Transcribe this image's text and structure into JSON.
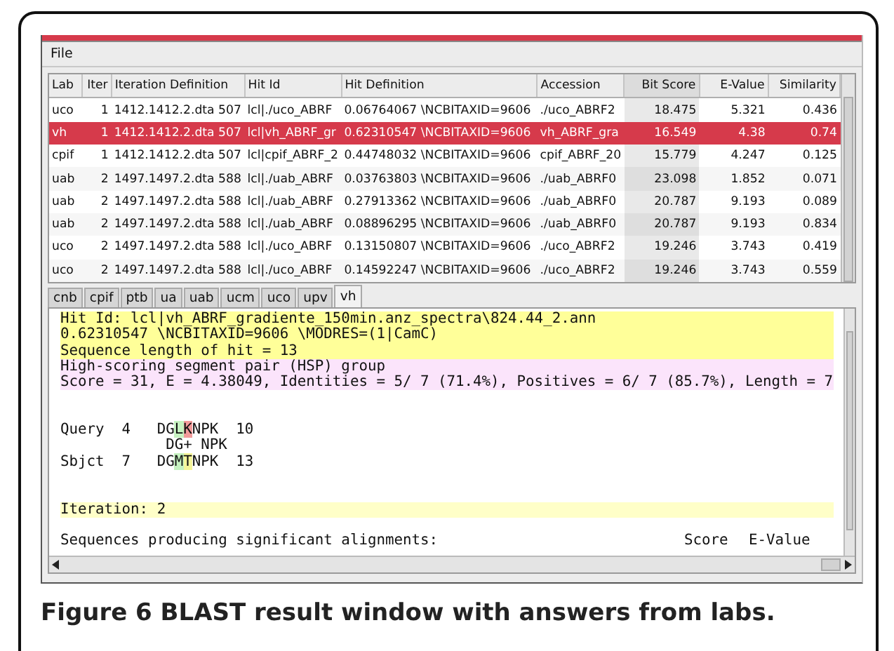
{
  "menu": [
    {
      "label": "File"
    }
  ],
  "table": {
    "columns": [
      {
        "label": "Lab",
        "kind": "text",
        "sorted": false
      },
      {
        "label": "Iter",
        "kind": "number",
        "sorted": false
      },
      {
        "label": "Iteration Definition",
        "kind": "text",
        "sorted": false
      },
      {
        "label": "Hit Id",
        "kind": "text",
        "sorted": false
      },
      {
        "label": "Hit Definition",
        "kind": "text",
        "sorted": false
      },
      {
        "label": "Accession",
        "kind": "text",
        "sorted": false
      },
      {
        "label": "Bit Score",
        "kind": "number",
        "sorted": true
      },
      {
        "label": "E-Value",
        "kind": "number",
        "sorted": false
      },
      {
        "label": "Similarity",
        "kind": "number",
        "sorted": false
      }
    ],
    "rows": [
      {
        "selected": false,
        "cells": [
          "uco",
          "1",
          "1412.1412.2.dta 507",
          "lcl|./uco_ABRF",
          "0.06764067 \\NCBITAXID=9606",
          "./uco_ABRF2",
          "18.475",
          "5.321",
          "0.436"
        ]
      },
      {
        "selected": true,
        "cells": [
          "vh",
          "1",
          "1412.1412.2.dta 507",
          "lcl|vh_ABRF_gr",
          "0.62310547 \\NCBITAXID=9606",
          "vh_ABRF_gra",
          "16.549",
          "4.38",
          "0.74"
        ]
      },
      {
        "selected": false,
        "cells": [
          "cpif",
          "1",
          "1412.1412.2.dta 507",
          "lcl|cpif_ABRF_2",
          "0.44748032 \\NCBITAXID=9606",
          "cpif_ABRF_20",
          "15.779",
          "4.247",
          "0.125"
        ]
      },
      {
        "selected": false,
        "cells": [
          "uab",
          "2",
          "1497.1497.2.dta 588",
          "lcl|./uab_ABRF",
          "0.03763803 \\NCBITAXID=9606",
          "./uab_ABRF0",
          "23.098",
          "1.852",
          "0.071"
        ]
      },
      {
        "selected": false,
        "cells": [
          "uab",
          "2",
          "1497.1497.2.dta 588",
          "lcl|./uab_ABRF",
          "0.27913362 \\NCBITAXID=9606",
          "./uab_ABRF0",
          "20.787",
          "9.193",
          "0.089"
        ]
      },
      {
        "selected": false,
        "cells": [
          "uab",
          "2",
          "1497.1497.2.dta 588",
          "lcl|./uab_ABRF",
          "0.08896295 \\NCBITAXID=9606",
          "./uab_ABRF0",
          "20.787",
          "9.193",
          "0.834"
        ]
      },
      {
        "selected": false,
        "cells": [
          "uco",
          "2",
          "1497.1497.2.dta 588",
          "lcl|./uco_ABRF",
          "0.13150807 \\NCBITAXID=9606",
          "./uco_ABRF2",
          "19.246",
          "3.743",
          "0.419"
        ]
      },
      {
        "selected": false,
        "cells": [
          "uco",
          "2",
          "1497.1497.2.dta 588",
          "lcl|./uco_ABRF",
          "0.14592247 \\NCBITAXID=9606",
          "./uco_ABRF2",
          "19.246",
          "3.743",
          "0.559"
        ]
      }
    ]
  },
  "tabs": [
    {
      "label": "cnb",
      "selected": false
    },
    {
      "label": "cpif",
      "selected": false
    },
    {
      "label": "ptb",
      "selected": false
    },
    {
      "label": "ua",
      "selected": false
    },
    {
      "label": "uab",
      "selected": false
    },
    {
      "label": "ucm",
      "selected": false
    },
    {
      "label": "uco",
      "selected": false
    },
    {
      "label": "upv",
      "selected": false
    },
    {
      "label": "vh",
      "selected": true
    }
  ],
  "report": [
    {
      "kind": "hit",
      "text": "Hit Id: lcl|vh_ABRF_gradiente_150min.anz_spectra\\824.44_2.ann"
    },
    {
      "kind": "hit",
      "text": "0.62310547 \\NCBITAXID=9606 \\MODRES=(1|CamC)"
    },
    {
      "kind": "hit",
      "text": "Sequence length of hit = 13"
    },
    {
      "kind": "hsp",
      "text": "High-scoring segment pair (HSP) group"
    },
    {
      "kind": "hsp",
      "text": "Score = 31, E = 4.38049, Identities = 5/ 7 (71.4%), Positives = 6/ 7 (85.7%), Length = 7"
    },
    {
      "kind": "blank"
    },
    {
      "kind": "blank"
    },
    {
      "kind": "alignment",
      "parts": [
        {
          "text": "Query  4   DG"
        },
        {
          "text": "L",
          "color": "#c6f2c0"
        },
        {
          "text": "K",
          "color": "#f29a9a"
        },
        {
          "text": "NPK  10"
        }
      ]
    },
    {
      "kind": "plain",
      "text": "            DG+ NPK"
    },
    {
      "kind": "alignment",
      "parts": [
        {
          "text": "Sbjct  7   DG"
        },
        {
          "text": "M",
          "color": "#c6f2c0"
        },
        {
          "text": "T",
          "color": "#f5f59a"
        },
        {
          "text": "NPK  13"
        }
      ]
    },
    {
      "kind": "blank"
    },
    {
      "kind": "blank"
    },
    {
      "kind": "iteration",
      "text": "Iteration: 2"
    },
    {
      "kind": "blank"
    },
    {
      "kind": "columns",
      "text": "Sequences producing significant alignments:",
      "score": "Score",
      "evalue": "E-Value"
    }
  ],
  "caption": "**Figure 6 BLAST result window with answers from labs**."
}
